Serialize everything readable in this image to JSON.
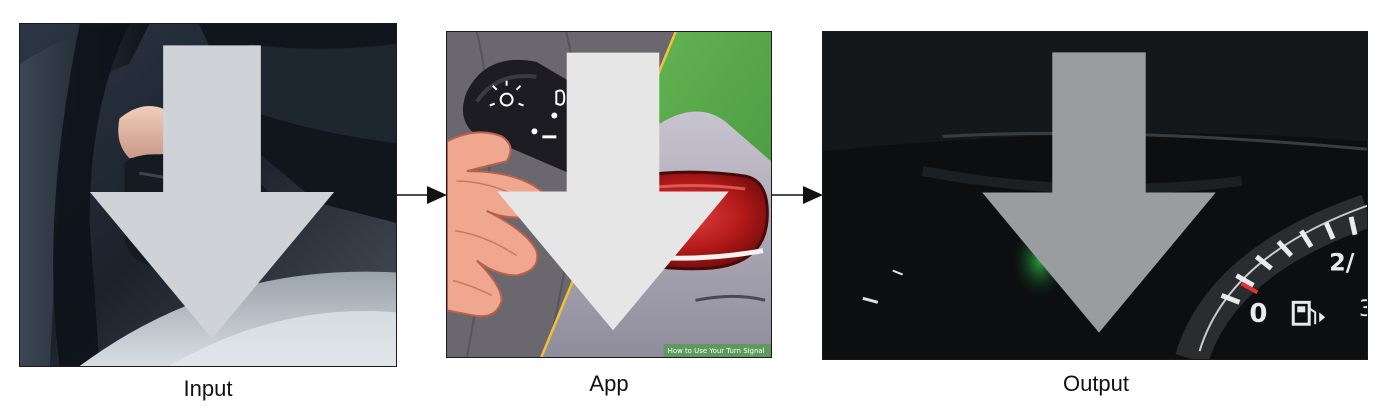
{
  "stages": [
    {
      "caption": "Input"
    },
    {
      "caption": "App",
      "watermark": "How to Use Your Turn Signal"
    },
    {
      "caption": "Output"
    }
  ]
}
